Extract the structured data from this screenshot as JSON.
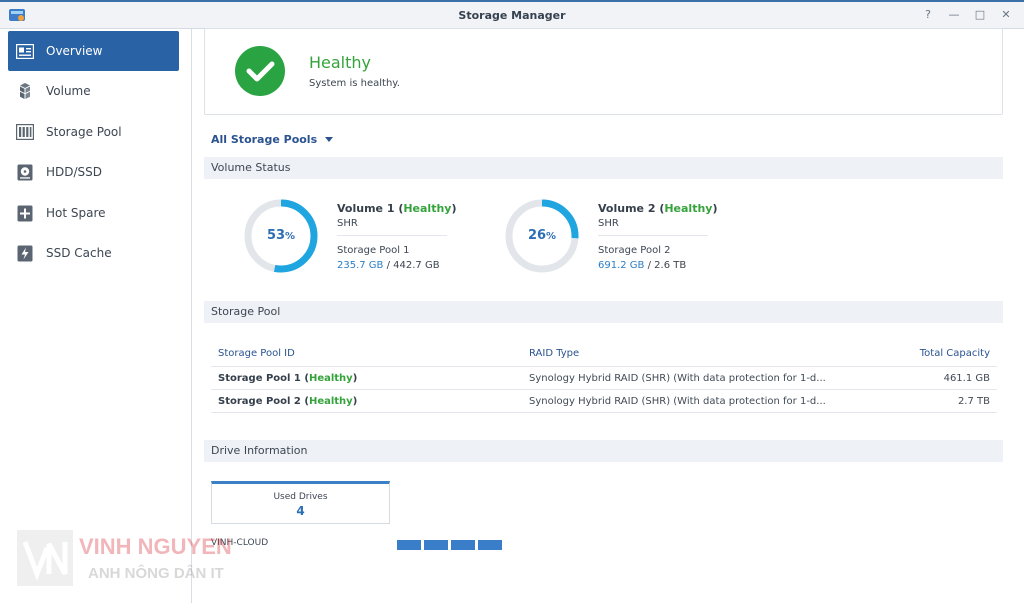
{
  "window": {
    "title": "Storage Manager",
    "controls": [
      "?",
      "—",
      "□",
      "✕"
    ]
  },
  "sidebar": {
    "items": [
      {
        "label": "Overview",
        "icon": "overview-icon",
        "active": true
      },
      {
        "label": "Volume",
        "icon": "volume-icon",
        "active": false
      },
      {
        "label": "Storage Pool",
        "icon": "storage-pool-icon",
        "active": false
      },
      {
        "label": "HDD/SSD",
        "icon": "hdd-icon",
        "active": false
      },
      {
        "label": "Hot Spare",
        "icon": "hot-spare-icon",
        "active": false
      },
      {
        "label": "SSD Cache",
        "icon": "ssd-cache-icon",
        "active": false
      }
    ]
  },
  "health": {
    "status": "Healthy",
    "description": "System is healthy."
  },
  "pool_filter": {
    "label": "All Storage Pools"
  },
  "volume_status": {
    "title": "Volume Status",
    "volumes": [
      {
        "name": "Volume 1",
        "status": "Healthy",
        "type": "SHR",
        "pool": "Storage Pool 1",
        "used": "235.7 GB",
        "total": "442.7 GB",
        "percent": 53,
        "percent_label": "53",
        "unit": "%"
      },
      {
        "name": "Volume 2",
        "status": "Healthy",
        "type": "SHR",
        "pool": "Storage Pool 2",
        "used": "691.2 GB",
        "total": "2.6 TB",
        "percent": 26,
        "percent_label": "26",
        "unit": "%"
      }
    ]
  },
  "storage_pool": {
    "title": "Storage Pool",
    "columns": [
      "Storage Pool ID",
      "RAID Type",
      "Total Capacity"
    ],
    "rows": [
      {
        "id": "Storage Pool 1",
        "status": "Healthy",
        "raid": "Synology Hybrid RAID (SHR) (With data protection for 1-d...",
        "capacity": "461.1 GB"
      },
      {
        "id": "Storage Pool 2",
        "status": "Healthy",
        "raid": "Synology Hybrid RAID (SHR) (With data protection for 1-d...",
        "capacity": "2.7 TB"
      }
    ]
  },
  "drive_info": {
    "title": "Drive Information",
    "used_drives_label": "Used Drives",
    "used_drives_count": "4",
    "host": "VINH-CLOUD",
    "slots": 4
  },
  "watermark": {
    "line1": "VINH NGUYEN",
    "line2": "ANH NÔNG DÂN IT"
  },
  "colors": {
    "accent": "#2a62a6",
    "healthy": "#35a33b",
    "ring_used": "#1fa6e0",
    "ring_track": "#e2e6ea"
  }
}
